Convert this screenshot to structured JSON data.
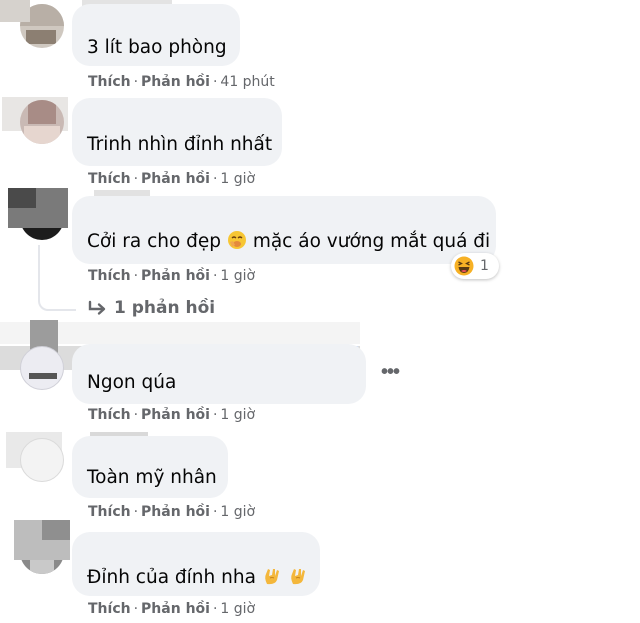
{
  "comments": [
    {
      "text": "3 lít bao phòng",
      "like": "Thích",
      "reply": "Phản hồi",
      "time": "41 phút"
    },
    {
      "text": "Trinh nhìn đỉnh nhất",
      "like": "Thích",
      "reply": "Phản hồi",
      "time": "1 giờ"
    },
    {
      "text_before": "Cởi ra cho đẹp",
      "text_after": "mặc áo vướng mắt quá đi",
      "emoji": "face-with-hand-over-mouth-icon",
      "like": "Thích",
      "reply": "Phản hồi",
      "time": "1 giờ",
      "reaction_count": "1",
      "reaction_icon": "haha-reaction-icon",
      "replies_label": "1 phản hồi"
    },
    {
      "text": "Ngon qúa",
      "like": "Thích",
      "reply": "Phản hồi",
      "time": "1 giờ"
    },
    {
      "text": "Toàn mỹ nhân",
      "like": "Thích",
      "reply": "Phản hồi",
      "time": "1 giờ"
    },
    {
      "text": "Đỉnh của đính nha",
      "emoji": "love-you-gesture-icon",
      "like": "Thích",
      "reply": "Phản hồi",
      "time": "1 giờ"
    }
  ],
  "icons": {
    "more": "more-options-icon",
    "reply_arrow": "reply-arrow-icon"
  },
  "colors": {
    "bubble": "#f0f2f5",
    "meta_text": "#65676b",
    "body_text": "#050505",
    "haha": "#f7b125"
  }
}
